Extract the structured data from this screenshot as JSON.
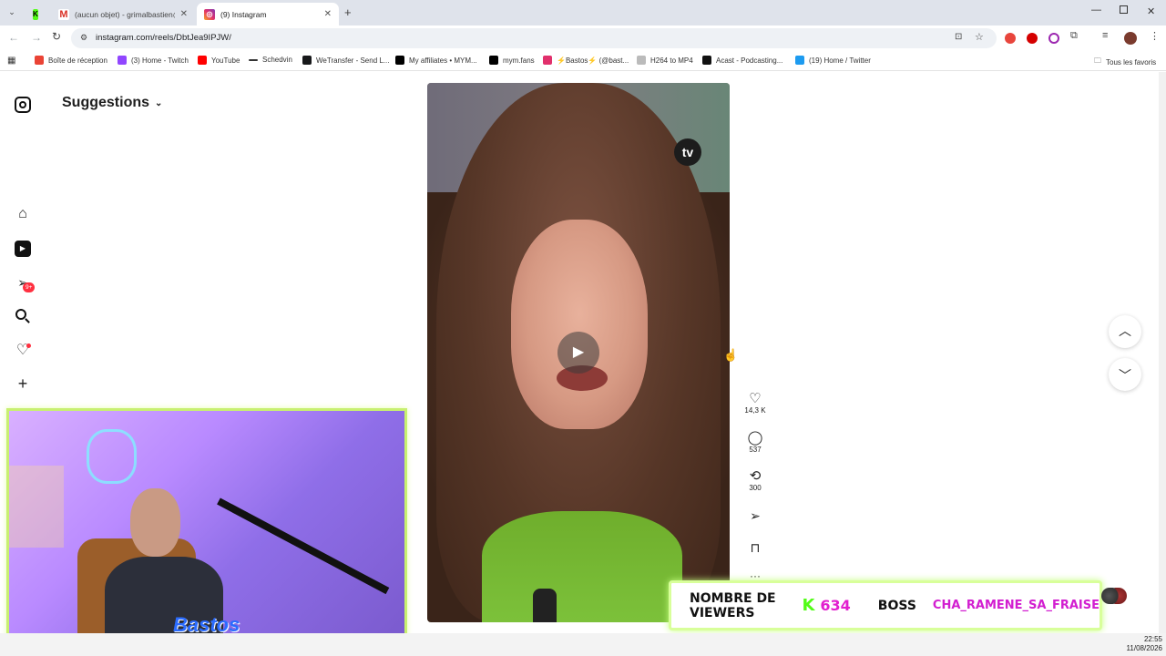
{
  "browser": {
    "tabs": [
      {
        "label": ""
      },
      {
        "label": "(aucun objet) - grimalbastien@"
      },
      {
        "label": "(9) Instagram"
      }
    ],
    "url": "instagram.com/reels/DbtJea9IPJW/",
    "bookmarks": [
      {
        "label": "Boîte de réception"
      },
      {
        "label": "(3) Home - Twitch"
      },
      {
        "label": "YouTube"
      },
      {
        "label": "Schedvin"
      },
      {
        "label": "WeTransfer - Send L..."
      },
      {
        "label": "My affiliates • MYM..."
      },
      {
        "label": "mym.fans"
      },
      {
        "label": "⚡Bastos⚡ (@bast..."
      },
      {
        "label": "H264 to MP4"
      },
      {
        "label": "Acast - Podcasting..."
      },
      {
        "label": "(19) Home / Twitter"
      }
    ],
    "all_bookmarks": "Tous les favoris"
  },
  "instagram": {
    "heading": "Suggestions",
    "notif_badge": "9+",
    "reel": {
      "channel_badge": "tv",
      "likes": "14,3 K",
      "comments": "537",
      "reposts": "300"
    }
  },
  "overlay": {
    "webcam_name": "Bastos",
    "viewers_label": "NOMBRE DE VIEWERS",
    "viewers_count": "634",
    "boss_label": "BOSS",
    "boss_name": "CHA_RAMENE_SA_FRAISE"
  },
  "taskbar": {
    "time": "22:55",
    "date": "11/08/2026"
  },
  "colors": {
    "accent_green": "#53fc18",
    "viewer_count": "#e21fcf",
    "boss_name": "#d21ed0",
    "notification_red": "#ff3040",
    "webcam_border": "#c8f070"
  }
}
